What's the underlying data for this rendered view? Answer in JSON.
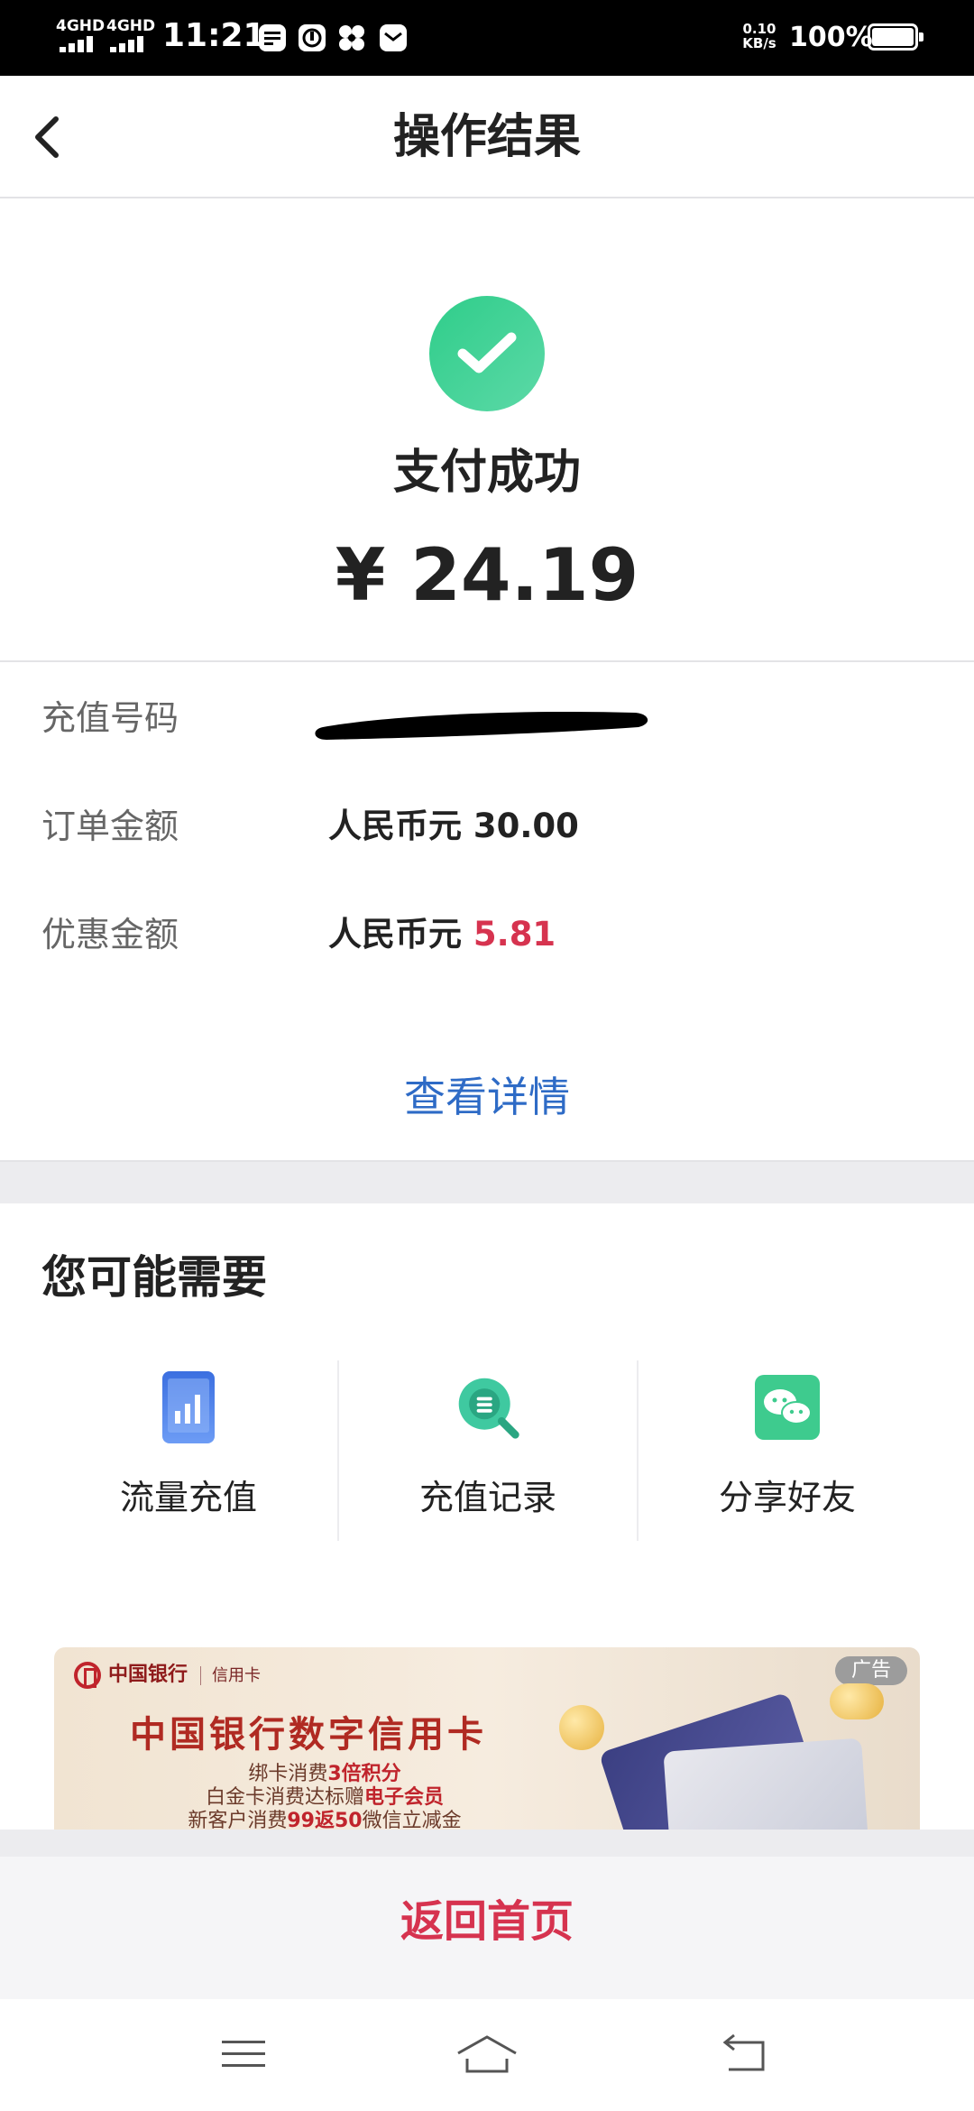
{
  "status_bar": {
    "net1": "4GHD",
    "net2": "4GHD",
    "time": "11:21",
    "speed_value": "0.10",
    "speed_unit": "KB/s",
    "battery": "100%"
  },
  "nav": {
    "title": "操作结果"
  },
  "result": {
    "status": "支付成功",
    "amount": "¥ 24.19",
    "accent_color": "#2fcd8a"
  },
  "details": {
    "rows": [
      {
        "label": "充值号码",
        "value": ""
      },
      {
        "label": "订单金额",
        "value": "人民币元 30.00"
      },
      {
        "label": "优惠金额",
        "prefix": "人民币元 ",
        "value": "5.81"
      }
    ],
    "view_details": "查看详情"
  },
  "suggest": {
    "title": "您可能需要",
    "items": [
      {
        "label": "流量充值",
        "icon": "phone-chart-icon"
      },
      {
        "label": "充值记录",
        "icon": "record-search-icon"
      },
      {
        "label": "分享好友",
        "icon": "wechat-icon"
      }
    ]
  },
  "ad": {
    "tag": "广告",
    "brand": "中国银行",
    "brand_sub": "信用卡",
    "headline": "中国银行数字信用卡",
    "line1_pre": "绑卡消费",
    "line1_hl": "3倍积分",
    "line2_pre": "白金卡消费达标赠",
    "line2_hl": "电子会员",
    "line3_pre": "新客户消费",
    "line3_hl": "99返50",
    "line3_post": "微信立减金"
  },
  "bottom": {
    "home_button": "返回首页"
  },
  "colors": {
    "link_blue": "#2e6bc6",
    "accent_red": "#d6334f"
  }
}
